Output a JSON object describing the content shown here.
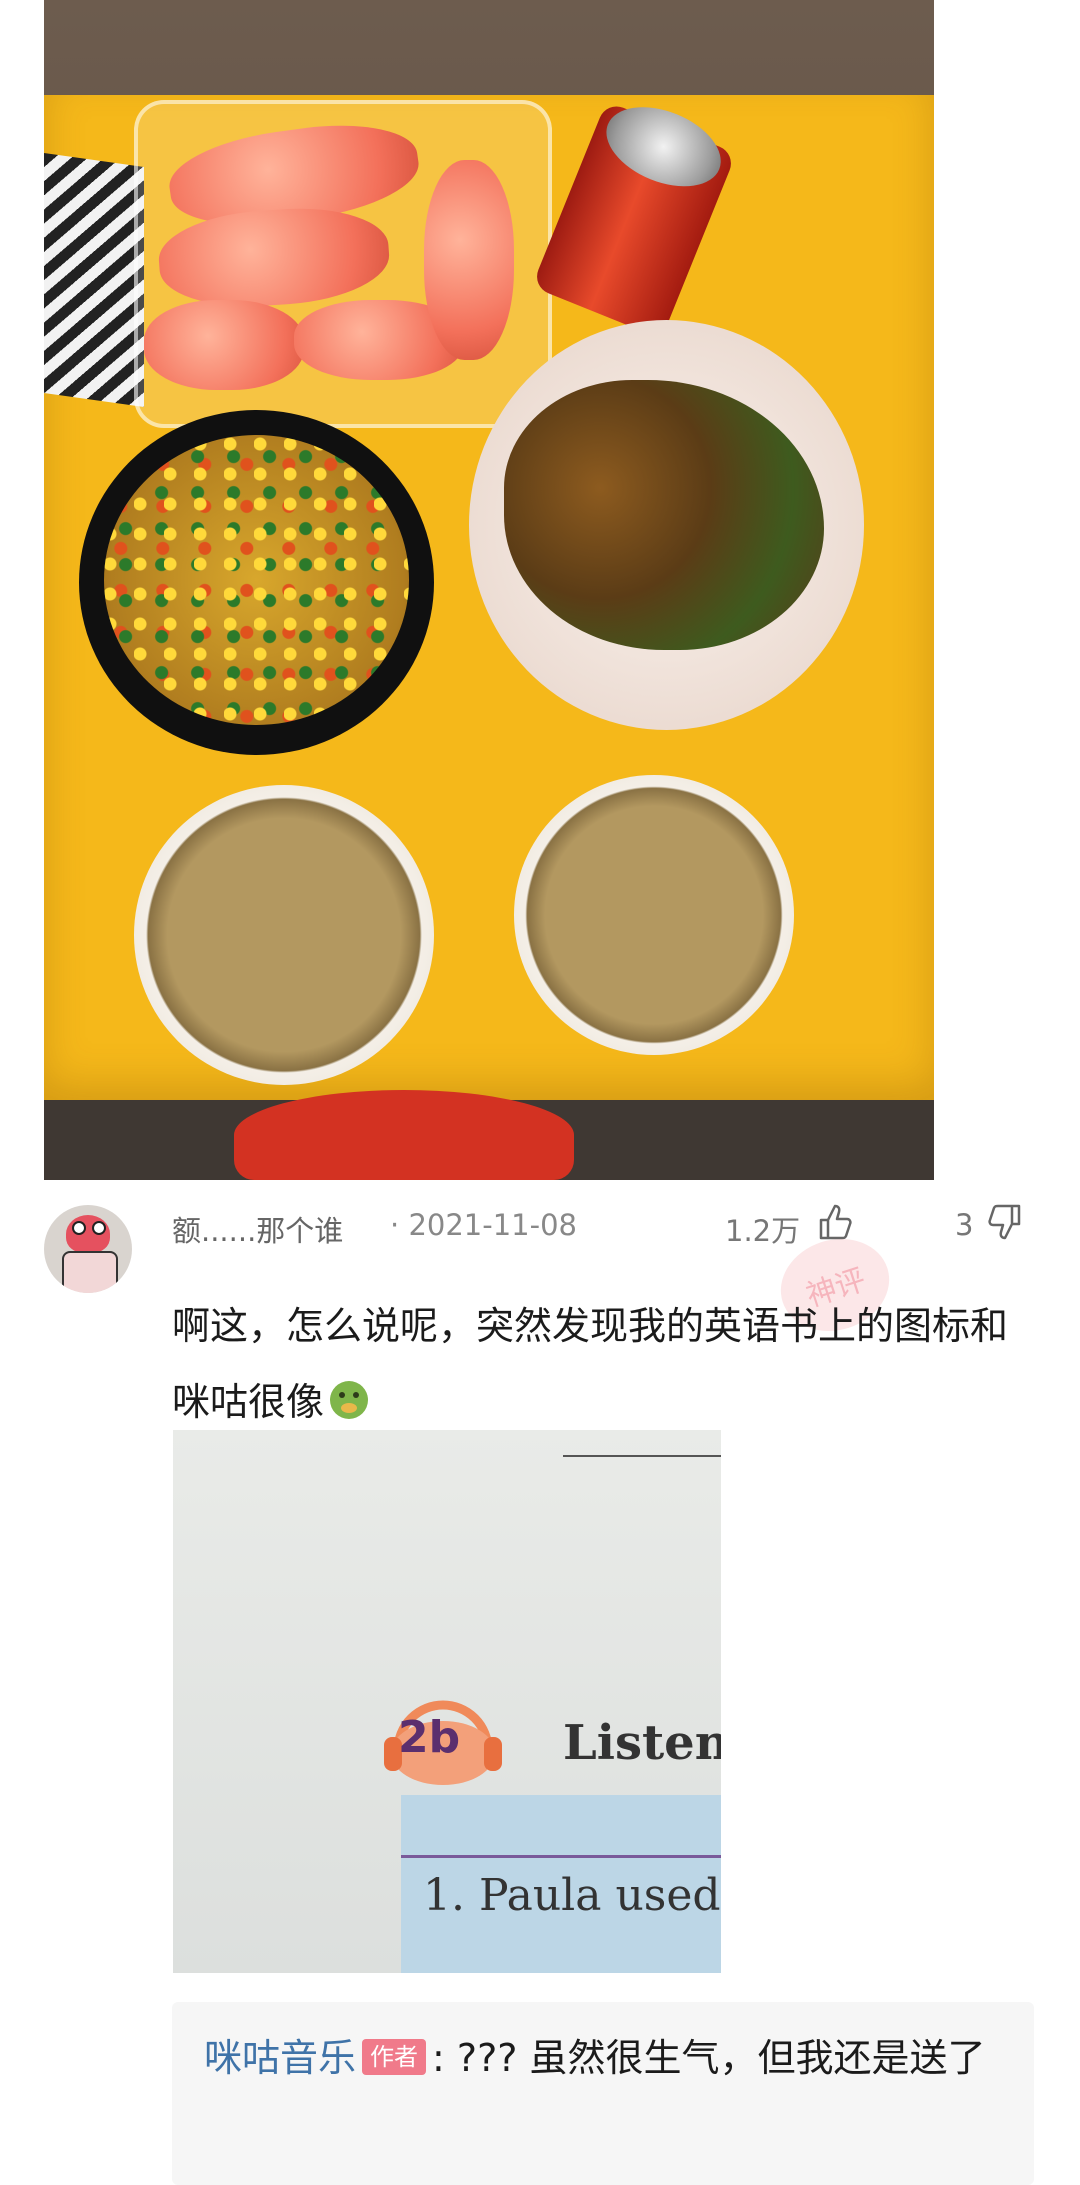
{
  "comment": {
    "username": "额......那个谁",
    "date_separator": "·",
    "date": "2021-11-08",
    "likes": "1.2万",
    "dislikes": "3",
    "text": "啊这，怎么说呢，突然发现我的英语书上的图标和咪咕很像",
    "emoji": "nauseated-face-emoji"
  },
  "attached_image": {
    "badge": "2b",
    "heading": "Listen",
    "line_text": "1. Paula used"
  },
  "reply": {
    "author": "咪咕音乐",
    "author_tag": "作者",
    "text": ": ??? 虽然很生气，但我还是送了"
  },
  "colors": {
    "reply_author": "#3f73a8",
    "author_tag_bg": "#f07a8a",
    "table_yellow": "#f5b81a"
  }
}
